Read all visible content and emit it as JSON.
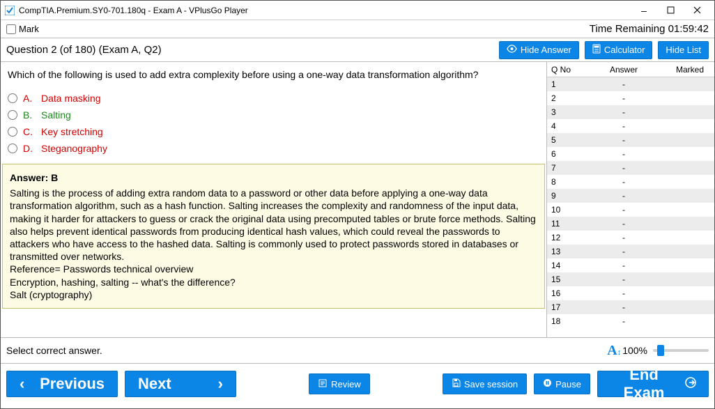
{
  "window": {
    "title": "CompTIA.Premium.SY0-701.180q - Exam A - VPlusGo Player"
  },
  "markbar": {
    "mark_label": "Mark",
    "timer_label": "Time Remaining",
    "timer_value": "01:59:42"
  },
  "toolbar": {
    "question_label": "Question 2 (of 180)  (Exam A, Q2)",
    "hide_answer": "Hide Answer",
    "calculator": "Calculator",
    "hide_list": "Hide List"
  },
  "question": {
    "text": "Which of the following is used to add extra complexity before using a one-way data transformation algorithm?",
    "choices": [
      {
        "letter": "A.",
        "text": "Data masking",
        "state": "wrong"
      },
      {
        "letter": "B.",
        "text": "Salting",
        "state": "correct"
      },
      {
        "letter": "C.",
        "text": "Key stretching",
        "state": "wrong"
      },
      {
        "letter": "D.",
        "text": "Steganography",
        "state": "wrong"
      }
    ],
    "answer_header": "Answer: B",
    "explanation": "Salting is the process of adding extra random data to a password or other data before applying a one-way data transformation algorithm, such as a hash function. Salting increases the complexity and randomness of the input data, making it harder for attackers to guess or crack the original data using precomputed tables or brute force methods. Salting also helps prevent identical passwords from producing identical hash values, which could reveal the passwords to attackers who have access to the hashed data. Salting is commonly used to protect passwords stored in databases or transmitted over networks.",
    "refs": [
      "Reference= Passwords technical overview",
      "Encryption, hashing, salting -- what's the difference?",
      "Salt (cryptography)"
    ]
  },
  "list": {
    "col_qno": "Q No",
    "col_answer": "Answer",
    "col_marked": "Marked",
    "rows": [
      {
        "q": "1",
        "a": "-",
        "m": ""
      },
      {
        "q": "2",
        "a": "-",
        "m": ""
      },
      {
        "q": "3",
        "a": "-",
        "m": ""
      },
      {
        "q": "4",
        "a": "-",
        "m": ""
      },
      {
        "q": "5",
        "a": "-",
        "m": ""
      },
      {
        "q": "6",
        "a": "-",
        "m": ""
      },
      {
        "q": "7",
        "a": "-",
        "m": ""
      },
      {
        "q": "8",
        "a": "-",
        "m": ""
      },
      {
        "q": "9",
        "a": "-",
        "m": ""
      },
      {
        "q": "10",
        "a": "-",
        "m": ""
      },
      {
        "q": "11",
        "a": "-",
        "m": ""
      },
      {
        "q": "12",
        "a": "-",
        "m": ""
      },
      {
        "q": "13",
        "a": "-",
        "m": ""
      },
      {
        "q": "14",
        "a": "-",
        "m": ""
      },
      {
        "q": "15",
        "a": "-",
        "m": ""
      },
      {
        "q": "16",
        "a": "-",
        "m": ""
      },
      {
        "q": "17",
        "a": "-",
        "m": ""
      },
      {
        "q": "18",
        "a": "-",
        "m": ""
      }
    ]
  },
  "status": {
    "message": "Select correct answer.",
    "zoom_pct": "100%"
  },
  "footer": {
    "previous": "Previous",
    "next": "Next",
    "review": "Review",
    "save": "Save session",
    "pause": "Pause",
    "end": "End Exam"
  }
}
